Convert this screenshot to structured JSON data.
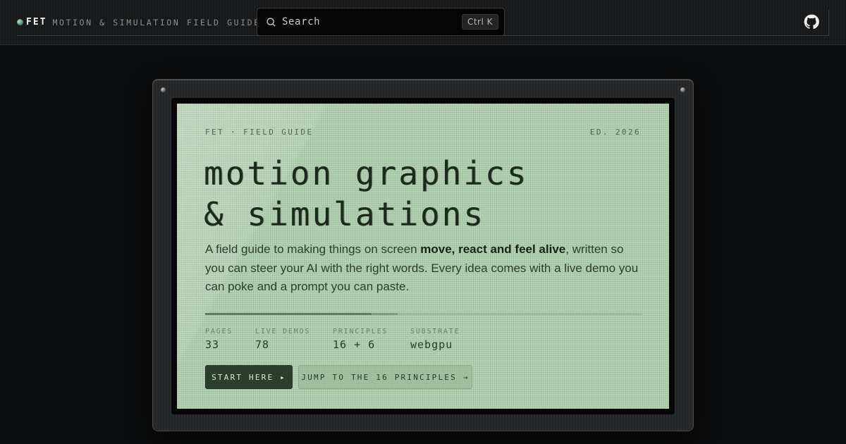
{
  "header": {
    "brand_mark": "FET",
    "brand_subtitle": "MOTION & SIMULATION FIELD GUIDE",
    "search": {
      "placeholder": "Search",
      "shortcut": "Ctrl K"
    },
    "github_icon": "github-icon"
  },
  "hero": {
    "eyebrow_left": "FET · FIELD GUIDE",
    "eyebrow_right": "ED. 2026",
    "headline_line1": "motion graphics",
    "headline_line2": "& simulations",
    "lead_part1": "A field guide to making things on screen ",
    "lead_bold": "move, react and feel alive",
    "lead_part2": ", written so you can steer your AI with the right words. Every idea comes with a live demo you can poke and a prompt you can paste.",
    "stats": [
      {
        "label": "PAGES",
        "value": "33"
      },
      {
        "label": "LIVE DEMOS",
        "value": "78"
      },
      {
        "label": "PRINCIPLES",
        "value": "16 + 6"
      },
      {
        "label": "SUBSTRATE",
        "value": "webgpu"
      }
    ],
    "primary_button": "START HERE ▸",
    "secondary_button": "JUMP TO THE 16 PRINCIPLES →"
  },
  "colors": {
    "page_bg": "#0b0c0d",
    "screen_bg": "#b6d2b4",
    "primary_button_bg": "#2c3f2c",
    "brand_dot": "#3f7a5a"
  }
}
